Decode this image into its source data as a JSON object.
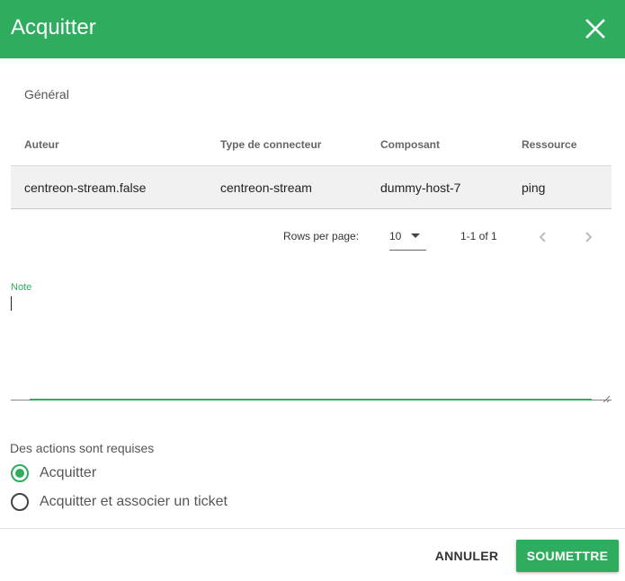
{
  "dialog": {
    "title": "Acquitter",
    "accent_color": "#2fad5f",
    "close_icon": "close-icon"
  },
  "general": {
    "section_title": "Général",
    "columns": [
      "Auteur",
      "Type de connecteur",
      "Composant",
      "Ressource"
    ],
    "rows": [
      [
        "centreon-stream.false",
        "centreon-stream",
        "dummy-host-7",
        "ping"
      ]
    ]
  },
  "pagination": {
    "rows_per_page_label": "Rows per page:",
    "rows_per_page_value": "10",
    "range_text": "1-1 of 1",
    "prev_icon": "chevron-left-icon",
    "next_icon": "chevron-right-icon"
  },
  "note": {
    "label": "Note",
    "value": ""
  },
  "actions": {
    "label": "Des actions sont requises",
    "options": [
      {
        "label": "Acquitter",
        "selected": true
      },
      {
        "label": "Acquitter et associer un ticket",
        "selected": false
      }
    ]
  },
  "footer": {
    "cancel_label": "ANNULER",
    "submit_label": "SOUMETTRE"
  }
}
